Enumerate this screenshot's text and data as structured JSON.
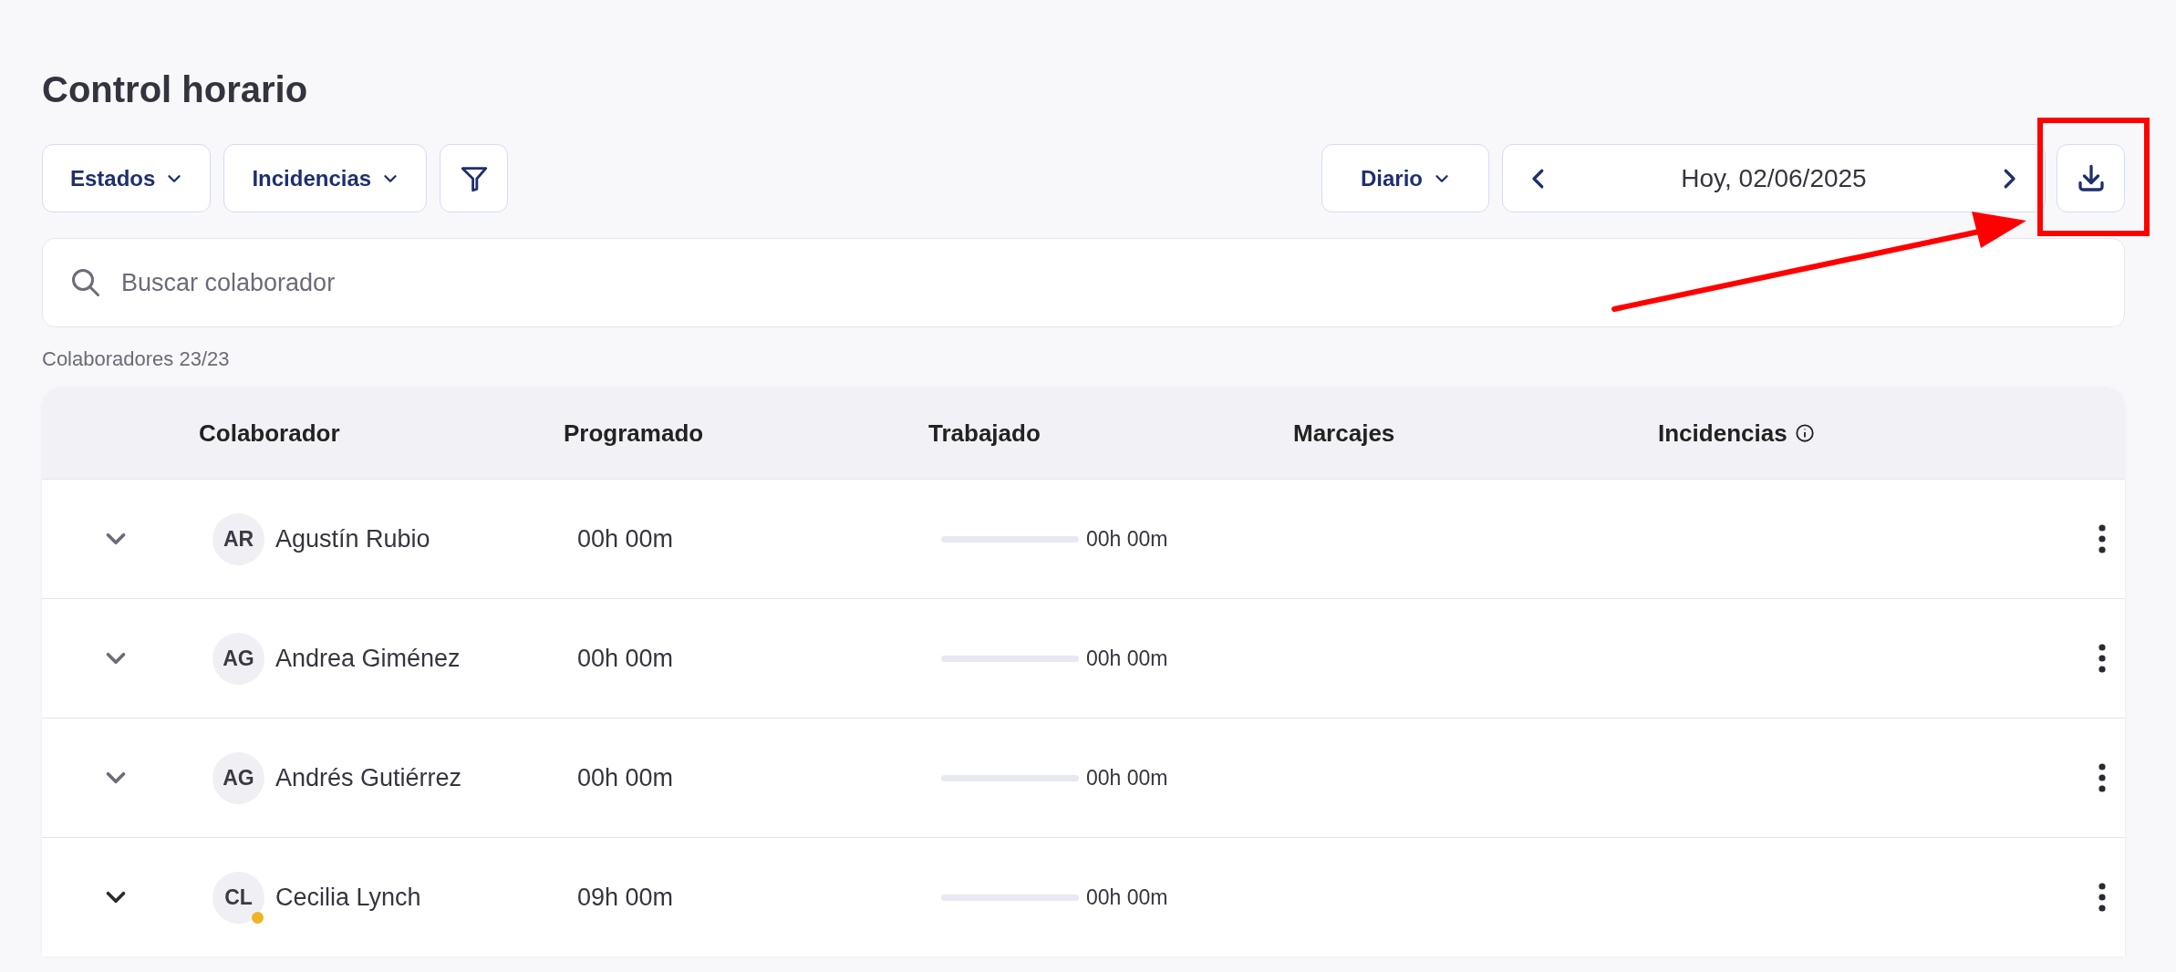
{
  "title": "Control horario",
  "filters": [
    {
      "label": "Estados",
      "kind": "dropdown"
    },
    {
      "label": "Incidencias",
      "kind": "dropdown"
    },
    {
      "kind": "filter"
    }
  ],
  "view": {
    "label": "Diario"
  },
  "date_nav": {
    "label": "Hoy, 02/06/2025"
  },
  "search": {
    "placeholder": "Buscar colaborador"
  },
  "count": "Colaboradores 23/23",
  "table": {
    "columns": [
      "Colaborador",
      "Programado",
      "Trabajado",
      "Marcajes",
      "Incidencias"
    ],
    "rows": [
      {
        "initials": "AR",
        "name": "Agustín Rubio",
        "scheduled": "00h 00m",
        "worked": "00h 00m",
        "level": 0
      },
      {
        "initials": "AG",
        "name": "Andrea Giménez",
        "scheduled": "00h 00m",
        "worked": "00h 00m",
        "level": 0
      },
      {
        "initials": "AG",
        "name": "Andrés Gutiérrez",
        "scheduled": "00h 00m",
        "worked": "00h 00m",
        "level": 0
      },
      {
        "initials": "CL",
        "name": "Cecilia Lynch",
        "scheduled": "09h 00m",
        "worked": "00h 00m",
        "level": 0,
        "color": "#f0b323"
      }
    ]
  },
  "annotations": {
    "highlight_frame": true,
    "arrow": true
  }
}
